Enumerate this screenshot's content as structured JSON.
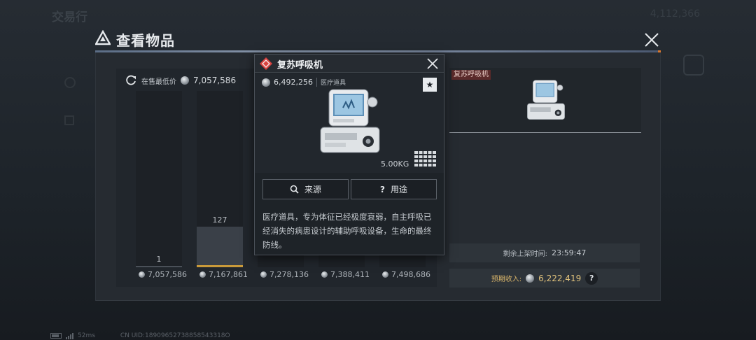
{
  "background": {
    "back_label": "交易行",
    "currency_text": "4,112,366"
  },
  "modal": {
    "title": "查看物品"
  },
  "market": {
    "lowest_label": "在售最低价",
    "lowest_price": "7,057,586",
    "bars_title": "",
    "colors": {
      "bar": "#3a4048",
      "selected_base": "#c99a3a"
    }
  },
  "chart_data": {
    "type": "bar",
    "categories": [
      "7,057,586",
      "7,167,861",
      "7,278,136",
      "7,388,411",
      "7,498,686"
    ],
    "values": [
      1,
      127,
      null,
      null,
      null
    ],
    "selected_index": 1
  },
  "tooltip": {
    "name": "复苏呼吸机",
    "price": "6,492,256",
    "category": "医疗道具",
    "weight": "5.00KG",
    "source_label": "来源",
    "use_label": "用途",
    "description": "医疗道具，专为体征已经极度衰弱，自主呼吸已经消失的病患设计的辅助呼吸设备，生命的最终防线。"
  },
  "sale": {
    "item_tag": "复苏呼吸机",
    "time_label": "剩余上架时间:",
    "time_value": "23:59:47",
    "income_label": "预期收入:",
    "income_value": "6,222,419",
    "help_label": "?"
  },
  "footer": {
    "ping": "52ms",
    "uid": "CN UID:18909652738858543318O"
  }
}
